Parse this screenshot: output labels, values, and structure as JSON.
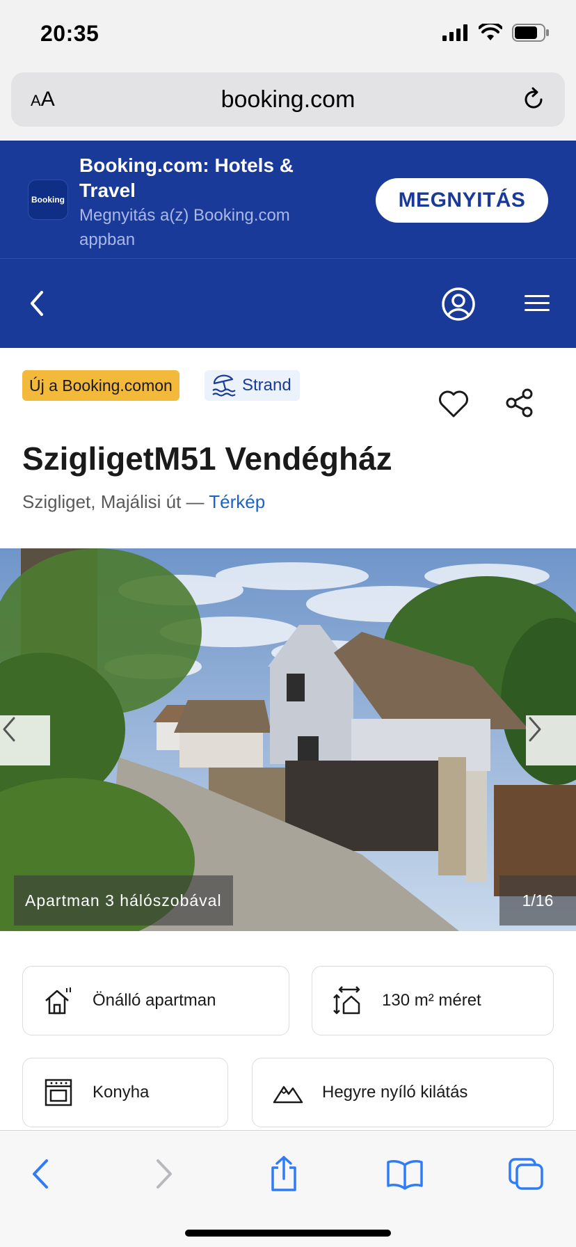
{
  "status_bar": {
    "time": "20:35"
  },
  "browser": {
    "text_size_label_small": "A",
    "text_size_label_large": "A",
    "url": "booking.com"
  },
  "app_banner": {
    "logo_text": "Booking",
    "title": "Booking.com: Hotels & Travel",
    "subtitle": "Megnyitás a(z) Booking.com appban",
    "open_button": "MEGNYITÁS"
  },
  "property": {
    "badge_new": "Új a Booking.comon",
    "badge_beach": "Strand",
    "title": "SzigligetM51 Vendégház",
    "address": "Szigliget, Majálisi út — ",
    "map_link": "Térkép"
  },
  "gallery": {
    "caption": "Apartman 3 hálószobával",
    "counter": "1/16"
  },
  "features": [
    {
      "label": "Önálló apartman",
      "icon": "house-icon"
    },
    {
      "label": "130 m² méret",
      "icon": "size-icon"
    },
    {
      "label": "Konyha",
      "icon": "kitchen-icon"
    },
    {
      "label": "Hegyre nyíló kilátás",
      "icon": "mountain-icon"
    }
  ],
  "colors": {
    "brand": "#1a3a9a",
    "badge_yellow": "#f3b93a",
    "link": "#1a63c7",
    "ios_blue": "#2f7cf6"
  }
}
